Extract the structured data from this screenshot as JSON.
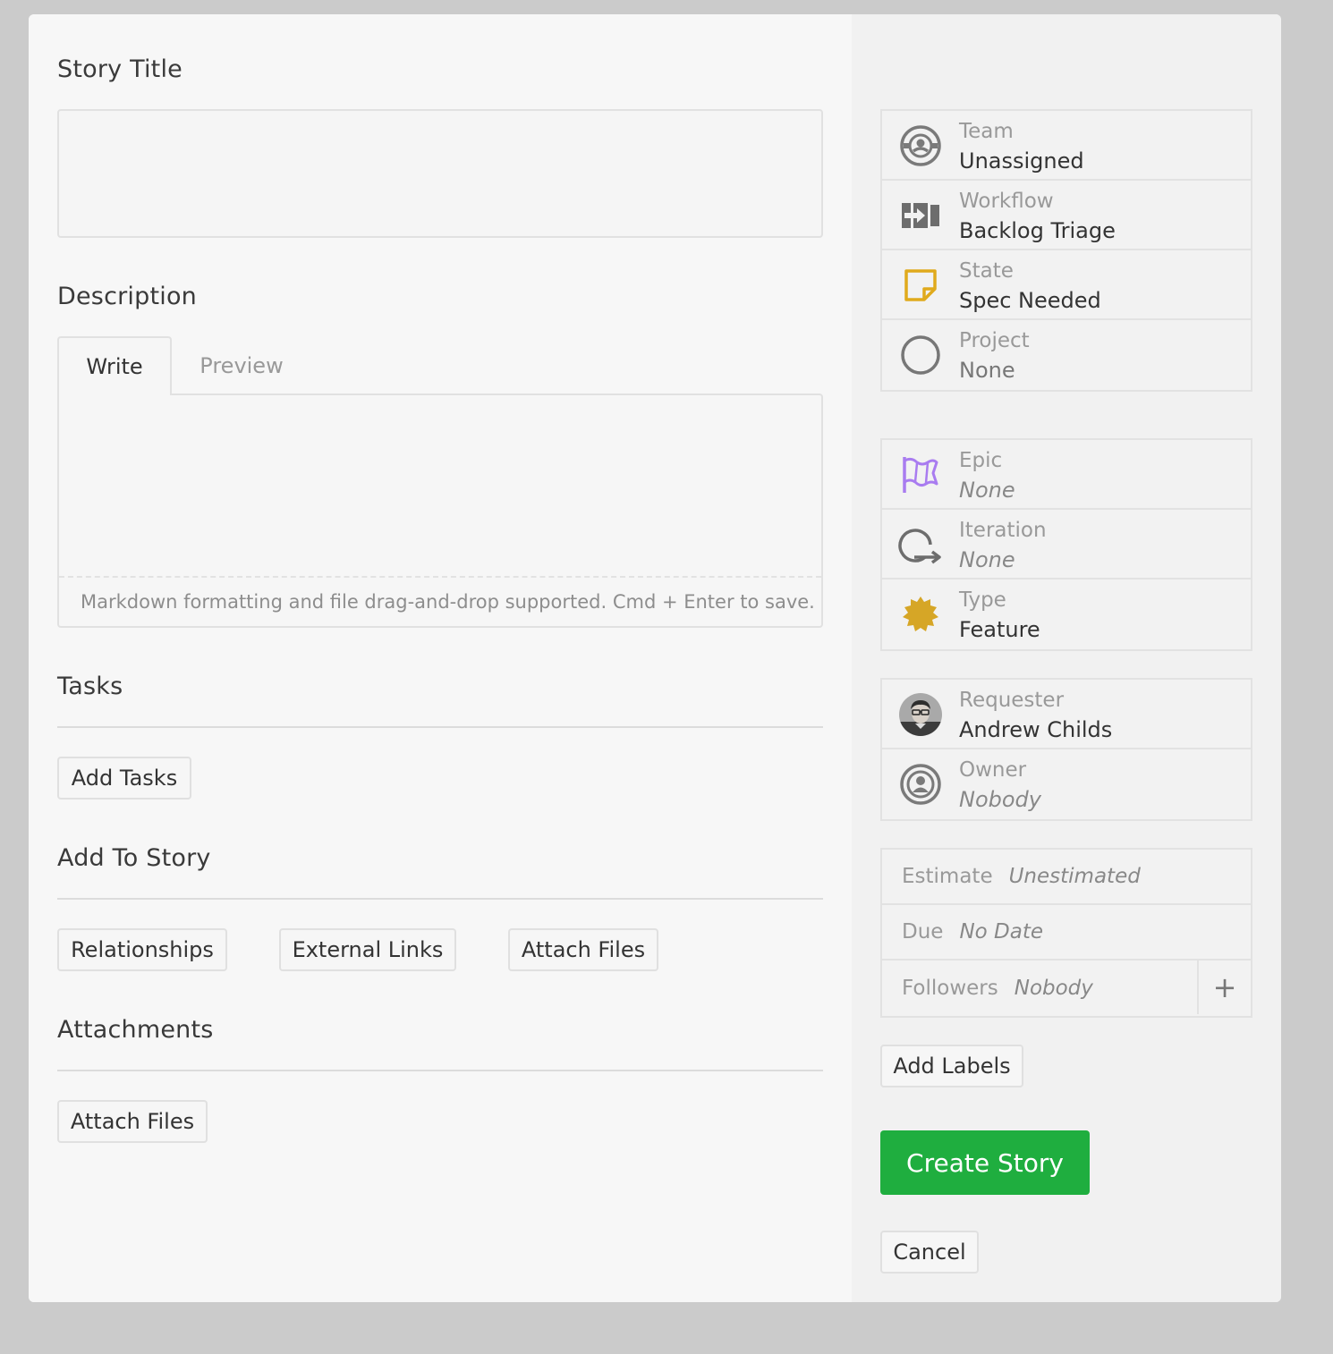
{
  "title_section": {
    "heading": "Story Title",
    "value": ""
  },
  "description": {
    "heading": "Description",
    "tabs": [
      {
        "label": "Write",
        "active": true
      },
      {
        "label": "Preview",
        "active": false
      }
    ],
    "value": "",
    "hint": "Markdown formatting and file drag-and-drop supported. Cmd + Enter to save."
  },
  "tasks": {
    "heading": "Tasks",
    "add_button": "Add Tasks"
  },
  "add_to_story": {
    "heading": "Add To Story",
    "buttons": [
      "Relationships",
      "External Links",
      "Attach Files"
    ]
  },
  "attachments": {
    "heading": "Attachments",
    "button": "Attach Files"
  },
  "sidebar": {
    "group1": [
      {
        "label": "Team",
        "value": "Unassigned",
        "icon": "team-icon"
      },
      {
        "label": "Workflow",
        "value": "Backlog Triage",
        "icon": "workflow-icon"
      },
      {
        "label": "State",
        "value": "Spec Needed",
        "icon": "state-icon"
      },
      {
        "label": "Project",
        "value": "None",
        "icon": "project-icon"
      }
    ],
    "group2": [
      {
        "label": "Epic",
        "value": "None",
        "icon": "epic-flag-icon"
      },
      {
        "label": "Iteration",
        "value": "None",
        "icon": "iteration-icon"
      },
      {
        "label": "Type",
        "value": "Feature",
        "icon": "feature-icon"
      }
    ],
    "group3": [
      {
        "label": "Requester",
        "value": "Andrew Childs",
        "icon": "avatar"
      },
      {
        "label": "Owner",
        "value": "Nobody",
        "icon": "owner-icon"
      }
    ],
    "group4": [
      {
        "label": "Estimate",
        "value": "Unestimated"
      },
      {
        "label": "Due",
        "value": "No Date"
      },
      {
        "label": "Followers",
        "value": "Nobody",
        "action": "+"
      }
    ],
    "add_labels": "Add Labels",
    "create": "Create Story",
    "cancel": "Cancel"
  },
  "colors": {
    "create_green": "#1fae3f",
    "state_yellow": "#e0aa1c",
    "feature_gold": "#d6a626",
    "epic_purple": "#a97cf0"
  }
}
